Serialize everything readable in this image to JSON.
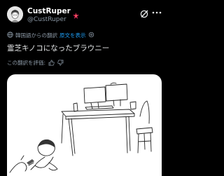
{
  "tweet": {
    "display_name": "CustRuper",
    "handle": "@CustRuper",
    "badge_icon": "bolt-star-icon",
    "translation": {
      "label": "韓国語からの翻訳",
      "show_original": "原文を表示",
      "rate_label": "この翻訳を評価:"
    },
    "text": "霊芝キノコになったブラウニー"
  },
  "colors": {
    "background": "#000000",
    "text": "#e7e9ea",
    "muted": "#8b98a5",
    "link": "#1d9bf0",
    "badge": "#e0245e"
  }
}
